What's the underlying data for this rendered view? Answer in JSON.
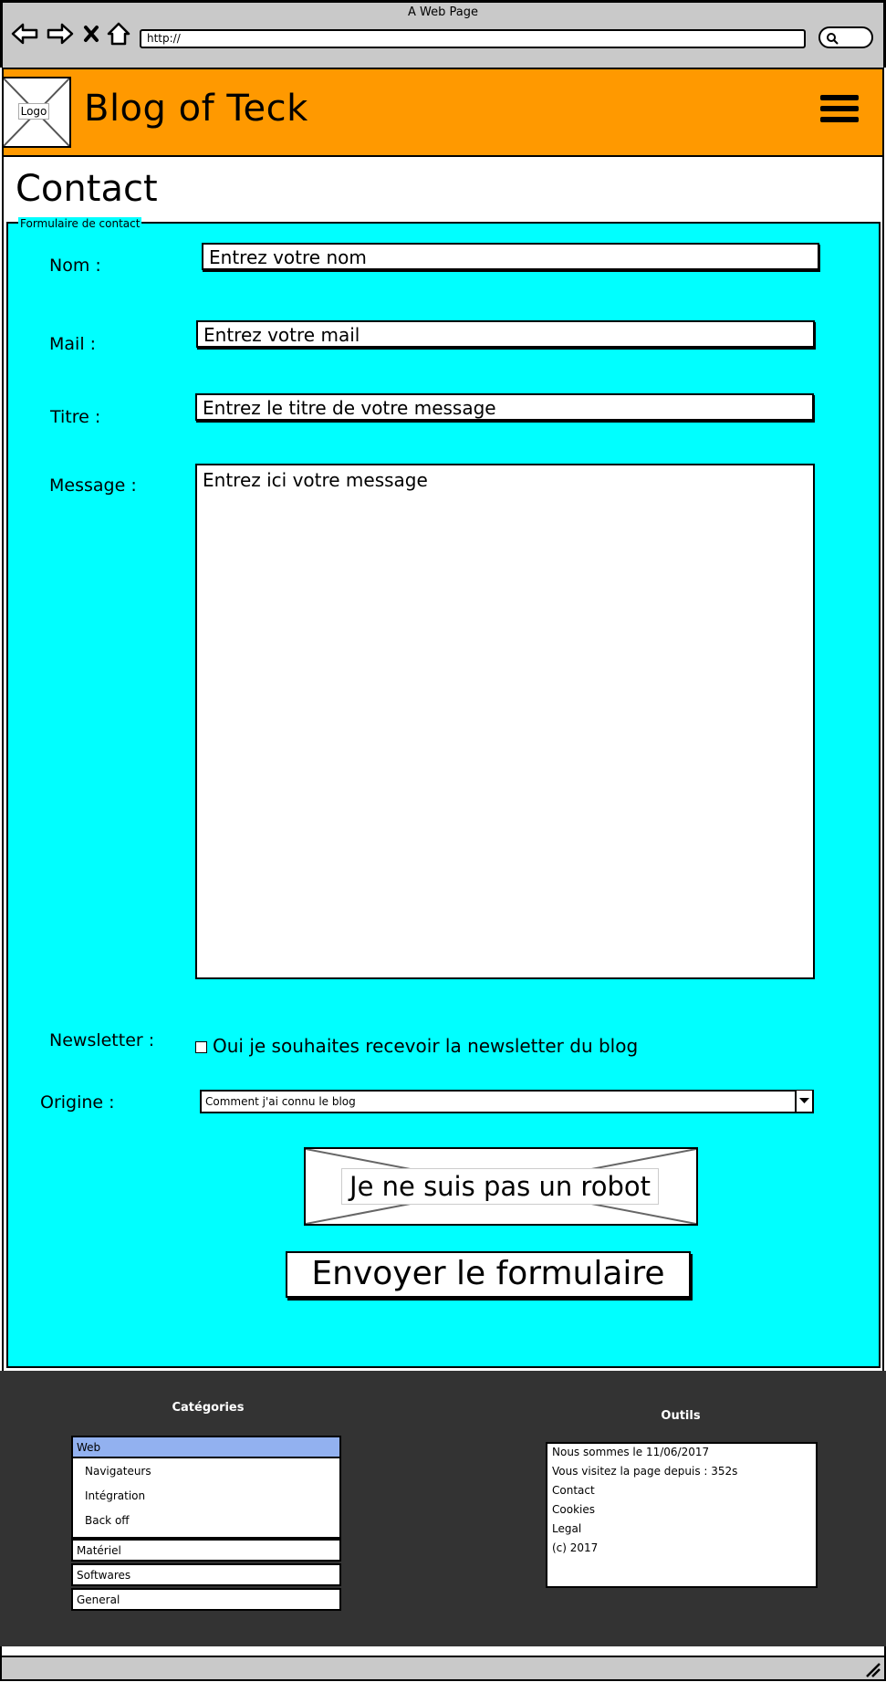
{
  "browser": {
    "window_title": "A Web Page",
    "url": "http://",
    "buttons": [
      "back-arrow-icon",
      "forward-arrow-icon",
      "stop-icon",
      "home-icon"
    ]
  },
  "header": {
    "logo_label": "Logo",
    "brand": "Blog of Teck",
    "menu_icon": "hamburger-menu-icon",
    "background_color": "#ff9900"
  },
  "page": {
    "title": "Contact"
  },
  "form": {
    "legend": "Formulaire de contact",
    "background_color": "#00ffff",
    "nom": {
      "label": "Nom :",
      "value": "Entrez votre nom"
    },
    "mail": {
      "label": "Mail :",
      "value": "Entrez votre mail"
    },
    "titre": {
      "label": "Titre :",
      "value": "Entrez le titre de votre message"
    },
    "message": {
      "label": "Message :",
      "value": "Entrez ici votre message"
    },
    "newsletter": {
      "label": "Newsletter :",
      "checkbox_label": "Oui je souhaites recevoir la newsletter du blog",
      "checked": false
    },
    "origine": {
      "label": "Origine :",
      "selected": "Comment j'ai connu le blog"
    },
    "captcha_label": "Je ne suis pas un robot",
    "submit_label": "Envoyer le formulaire"
  },
  "footer": {
    "categories_title": "Catégories",
    "categories": {
      "web": "Web",
      "web_children": [
        "Navigateurs",
        "Intégration",
        "Back off"
      ],
      "materiel": "Matériel",
      "softwares": "Softwares",
      "general": "General"
    },
    "tools_title": "Outils",
    "tools": [
      "Nous sommes le 11/06/2017",
      "Vous visitez la page depuis : 352s",
      "Contact",
      "Cookies",
      "Legal",
      "(c) 2017"
    ],
    "selected_color": "#92b1f0"
  }
}
